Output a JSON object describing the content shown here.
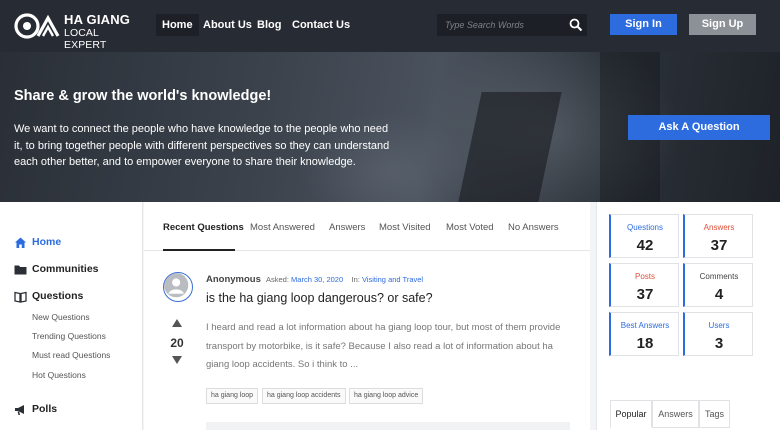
{
  "header": {
    "logo_top": "HA GIANG",
    "logo_bottom": "LOCAL EXPERT",
    "nav": [
      {
        "label": "Home"
      },
      {
        "label": "About Us"
      },
      {
        "label": "Blog"
      },
      {
        "label": "Contact Us"
      }
    ],
    "search_placeholder": "Type Search Words",
    "signin_label": "Sign In",
    "signup_label": "Sign Up"
  },
  "hero": {
    "title": "Share & grow the world's knowledge!",
    "text": "We want to connect the people who have knowledge to the people who need it, to bring together people with different perspectives so they can understand each other better, and to empower everyone to share their knowledge.",
    "ask_label": "Ask A Question"
  },
  "sidebar": {
    "items": [
      {
        "label": "Home",
        "icon": "home-icon"
      },
      {
        "label": "Communities",
        "icon": "folder-icon"
      },
      {
        "label": "Questions",
        "icon": "book-icon"
      },
      {
        "label": "Polls",
        "icon": "megaphone-icon"
      }
    ],
    "question_subitems": [
      "New Questions",
      "Trending Questions",
      "Must read Questions",
      "Hot Questions"
    ]
  },
  "main": {
    "tabs": [
      "Recent Questions",
      "Most Answered",
      "Answers",
      "Most Visited",
      "Most Voted",
      "No Answers"
    ],
    "question": {
      "author": "Anonymous",
      "asked_prefix": "Asked:",
      "date": "March 30, 2020",
      "in_prefix": "In:",
      "category": "Visiting and Travel",
      "title": "is the ha giang loop dangerous? or safe?",
      "votes": "20",
      "excerpt": "I heard and read a lot information about ha giang loop tour, but most of them provide transport by motorbike, is it safe? Because I also read a lot of information about ha giang loop accidents. So i think to ...",
      "tags": [
        "ha giang loop",
        "ha giang loop accidents",
        "ha giang loop advice"
      ]
    }
  },
  "stats": [
    {
      "label": "Questions",
      "value": "42",
      "color": "#2d6cdf"
    },
    {
      "label": "Answers",
      "value": "37",
      "color": "#e0503a"
    },
    {
      "label": "Posts",
      "value": "37",
      "color": "#e0503a"
    },
    {
      "label": "Comments",
      "value": "4",
      "color": "#444444"
    },
    {
      "label": "Best Answers",
      "value": "18",
      "color": "#2d6cdf"
    },
    {
      "label": "Users",
      "value": "3",
      "color": "#2d6cdf"
    }
  ],
  "widget_tabs": [
    "Popular",
    "Answers",
    "Tags"
  ],
  "colors": {
    "accent": "#2d6cdf",
    "header_bg": "#272b33",
    "secondary_button": "#8c9097"
  }
}
